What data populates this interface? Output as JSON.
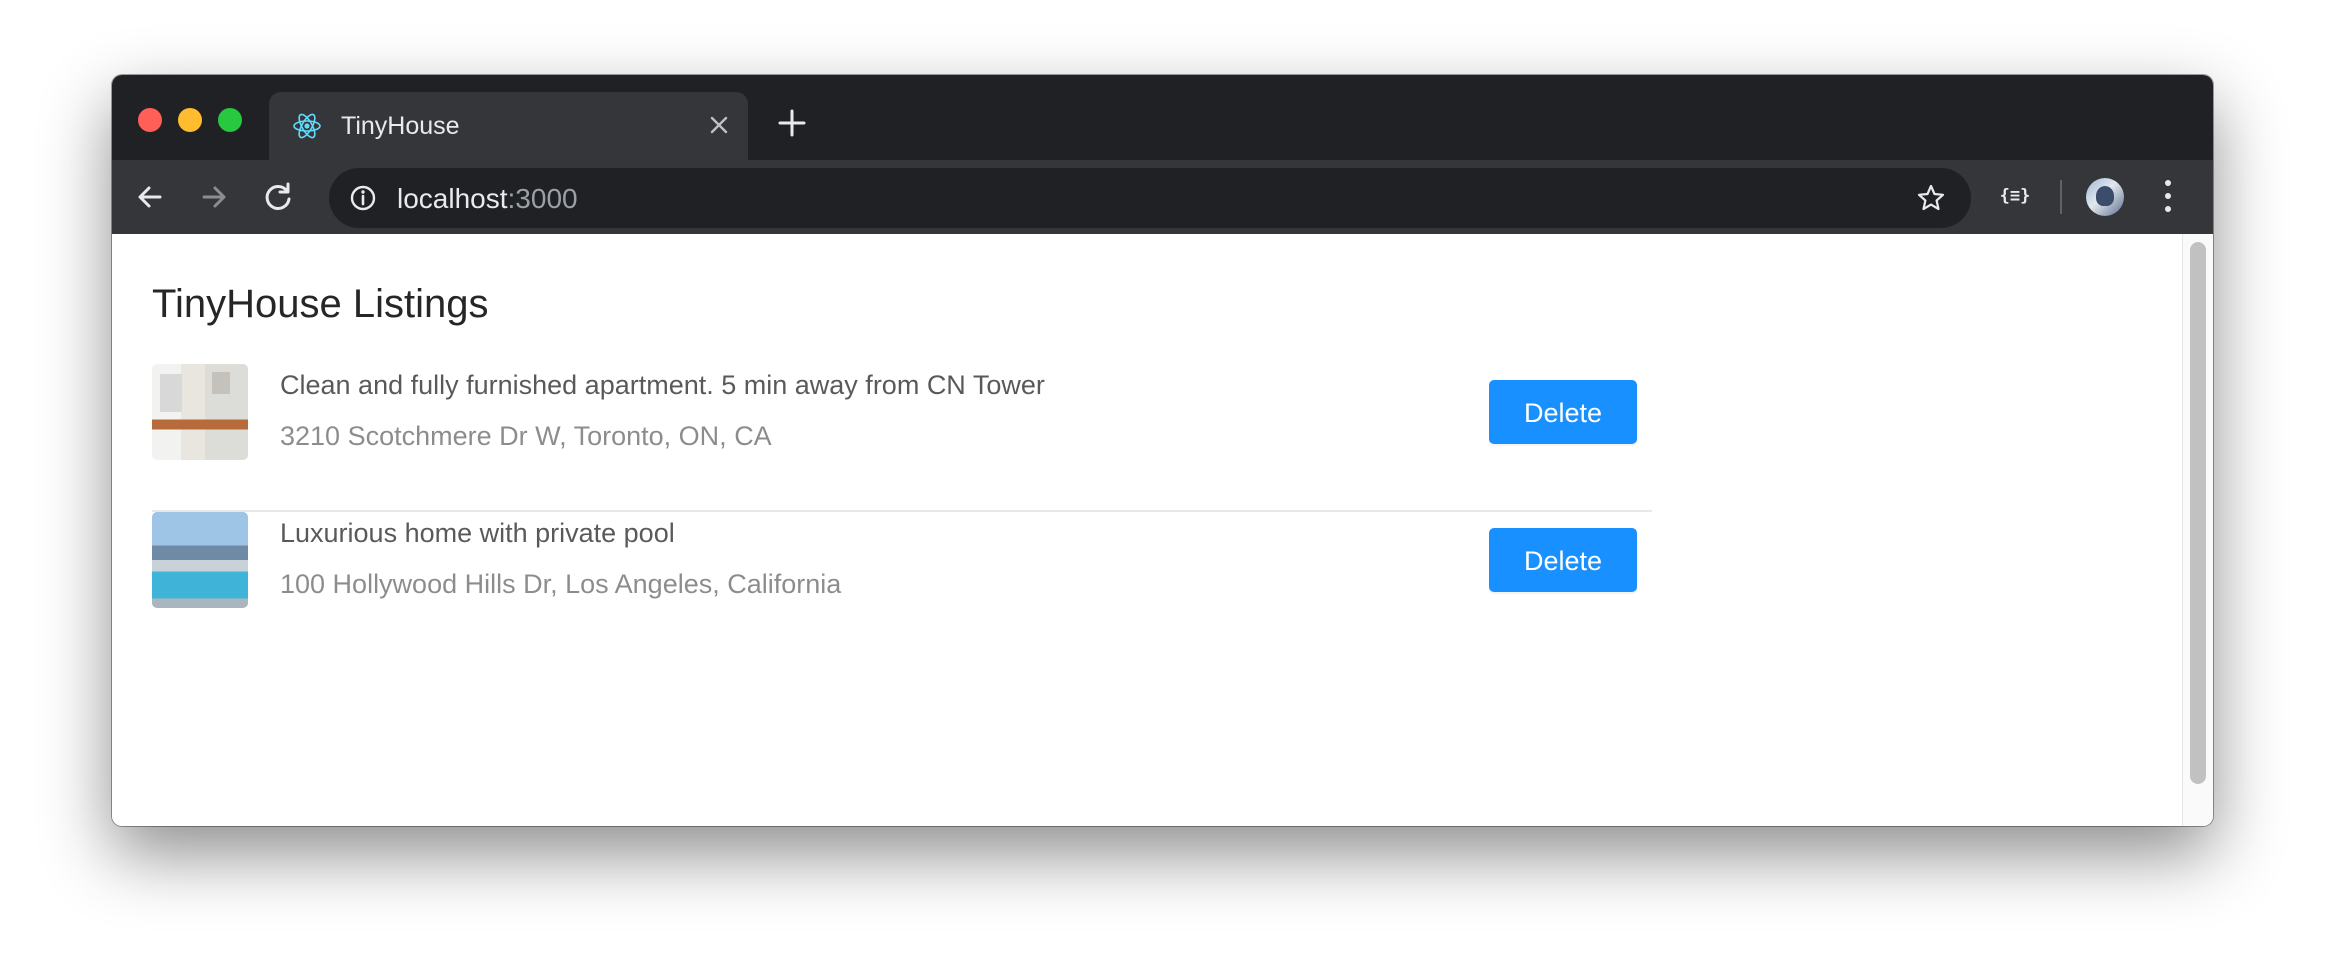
{
  "browser": {
    "tab": {
      "title": "TinyHouse",
      "favicon": "react-icon",
      "close_icon": "close-icon"
    },
    "new_tab_icon": "plus-icon",
    "nav": {
      "back_icon": "arrow-left-icon",
      "forward_icon": "arrow-right-icon",
      "reload_icon": "reload-icon"
    },
    "address": {
      "host": "localhost",
      "port": ":3000",
      "info_icon": "info-icon",
      "bookmark_icon": "star-icon"
    },
    "extension_label": "{≡}",
    "menu_icon": "more-vertical-icon"
  },
  "page": {
    "title": "TinyHouse Listings",
    "listings": [
      {
        "title": "Clean and fully furnished apartment. 5 min away from CN Tower",
        "address": "3210 Scotchmere Dr W, Toronto, ON, CA",
        "delete_label": "Delete"
      },
      {
        "title": "Luxurious home with private pool",
        "address": "100 Hollywood Hills Dr, Los Angeles, California",
        "delete_label": "Delete"
      }
    ]
  },
  "colors": {
    "primary": "#1890ff",
    "titlebar": "#202124",
    "toolbar": "#35363a"
  }
}
